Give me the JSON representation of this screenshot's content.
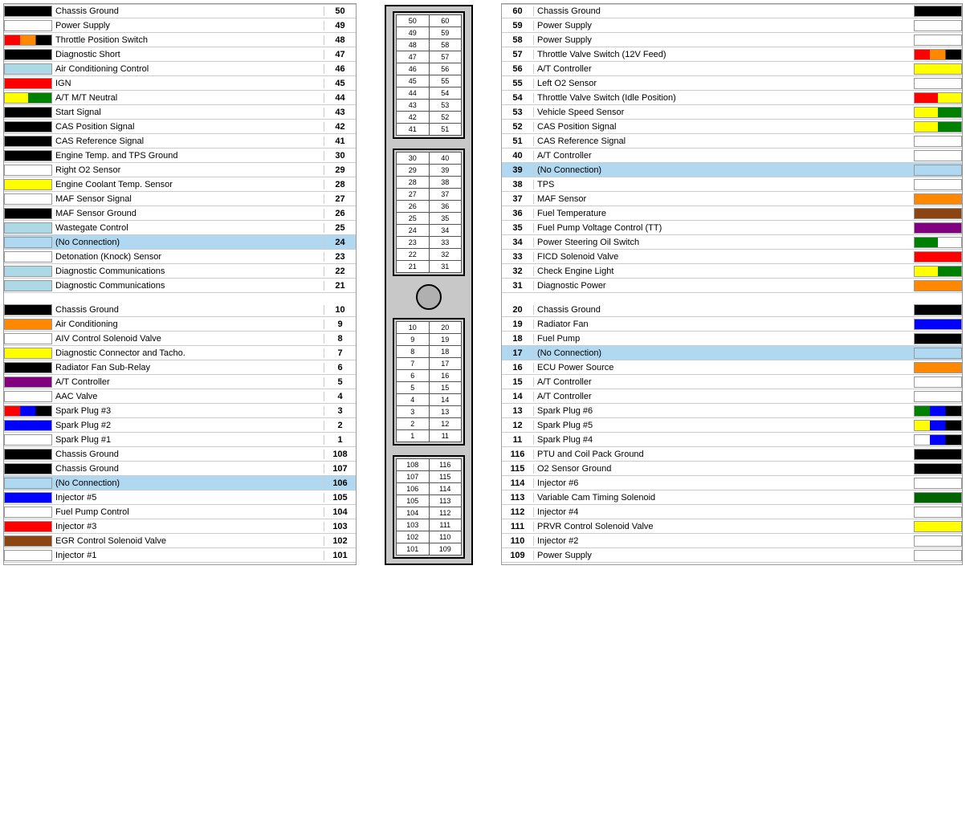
{
  "left": {
    "section1": [
      {
        "num": 50,
        "label": "Chassis Ground",
        "swatch": "swatch-black"
      },
      {
        "num": 49,
        "label": "Power Supply",
        "swatch": "swatch-none"
      },
      {
        "num": 48,
        "label": "Throttle Position Switch",
        "swatch": "swatch-multiRO"
      },
      {
        "num": 47,
        "label": "Diagnostic Short",
        "swatch": "swatch-black"
      },
      {
        "num": 46,
        "label": "Air Conditioning Control",
        "swatch": "swatch-lightblue"
      },
      {
        "num": 45,
        "label": "IGN",
        "swatch": "swatch-red"
      },
      {
        "num": 44,
        "label": "A/T M/T Neutral",
        "swatch": "swatch-multiYG"
      },
      {
        "num": 43,
        "label": "Start Signal",
        "swatch": "swatch-black"
      },
      {
        "num": 42,
        "label": "CAS Position Signal",
        "swatch": "swatch-black"
      },
      {
        "num": 41,
        "label": "CAS Reference Signal",
        "swatch": "swatch-black"
      },
      {
        "num": 30,
        "label": "Engine Temp. and TPS Ground",
        "swatch": "swatch-black"
      },
      {
        "num": 29,
        "label": "Right O2 Sensor",
        "swatch": "swatch-none"
      },
      {
        "num": 28,
        "label": "Engine Coolant Temp. Sensor",
        "swatch": "swatch-yellow"
      },
      {
        "num": 27,
        "label": "MAF Sensor Signal",
        "swatch": "swatch-none"
      },
      {
        "num": 26,
        "label": "MAF Sensor Ground",
        "swatch": "swatch-black"
      },
      {
        "num": 25,
        "label": "Wastegate Control",
        "swatch": "swatch-lightblue"
      },
      {
        "num": 24,
        "label": "(No Connection)",
        "swatch": "swatch-none",
        "nc": true
      },
      {
        "num": 23,
        "label": "Detonation (Knock) Sensor",
        "swatch": "swatch-none"
      },
      {
        "num": 22,
        "label": "Diagnostic Communications",
        "swatch": "swatch-lightblue"
      },
      {
        "num": 21,
        "label": "Diagnostic Communications",
        "swatch": "swatch-lightblue"
      }
    ],
    "section2": [
      {
        "num": 10,
        "label": "Chassis Ground",
        "swatch": "swatch-black"
      },
      {
        "num": 9,
        "label": "Air Conditioning",
        "swatch": "swatch-orange"
      },
      {
        "num": 8,
        "label": "AIV Control Solenoid Valve",
        "swatch": "swatch-none"
      },
      {
        "num": 7,
        "label": "Diagnostic Connector and Tacho.",
        "swatch": "swatch-yellow"
      },
      {
        "num": 6,
        "label": "Radiator Fan Sub-Relay",
        "swatch": "swatch-black"
      },
      {
        "num": 5,
        "label": "A/T Controller",
        "swatch": "swatch-purple"
      },
      {
        "num": 4,
        "label": "AAC Valve",
        "swatch": "swatch-none"
      },
      {
        "num": 3,
        "label": "Spark Plug #3",
        "swatch": "swatch-multiRBK"
      },
      {
        "num": 2,
        "label": "Spark Plug #2",
        "swatch": "swatch-blue"
      },
      {
        "num": 1,
        "label": "Spark Plug #1",
        "swatch": "swatch-none"
      },
      {
        "num": 108,
        "label": "Chassis Ground",
        "swatch": "swatch-black"
      },
      {
        "num": 107,
        "label": "Chassis Ground",
        "swatch": "swatch-black"
      },
      {
        "num": 106,
        "label": "(No Connection)",
        "swatch": "swatch-none",
        "nc": true
      },
      {
        "num": 105,
        "label": "Injector #5",
        "swatch": "swatch-blue"
      },
      {
        "num": 104,
        "label": "Fuel Pump Control",
        "swatch": "swatch-none"
      },
      {
        "num": 103,
        "label": "Injector #3",
        "swatch": "swatch-red"
      },
      {
        "num": 102,
        "label": "EGR Control Solenoid Valve",
        "swatch": "swatch-brown"
      },
      {
        "num": 101,
        "label": "Injector #1",
        "swatch": "swatch-none"
      }
    ]
  },
  "right": {
    "section1": [
      {
        "num": 60,
        "label": "Chassis Ground",
        "swatch": "swatch-black"
      },
      {
        "num": 59,
        "label": "Power Supply",
        "swatch": "swatch-none"
      },
      {
        "num": 58,
        "label": "Power Supply",
        "swatch": "swatch-none"
      },
      {
        "num": 57,
        "label": "Throttle Valve Switch (12V Feed)",
        "swatch": "swatch-multiRO"
      },
      {
        "num": 56,
        "label": "A/T Controller",
        "swatch": "swatch-yellow"
      },
      {
        "num": 55,
        "label": "Left O2 Sensor",
        "swatch": "swatch-none"
      },
      {
        "num": 54,
        "label": "Throttle Valve Switch (Idle Position)",
        "swatch": "swatch-multiRY"
      },
      {
        "num": 53,
        "label": "Vehicle Speed Sensor",
        "swatch": "swatch-multiYG"
      },
      {
        "num": 52,
        "label": "CAS Position Signal",
        "swatch": "swatch-multiYG"
      },
      {
        "num": 51,
        "label": "CAS Reference Signal",
        "swatch": "swatch-none"
      },
      {
        "num": 40,
        "label": "A/T Controller",
        "swatch": "swatch-none"
      },
      {
        "num": 39,
        "label": "(No Connection)",
        "swatch": "swatch-none",
        "nc": true
      },
      {
        "num": 38,
        "label": "TPS",
        "swatch": "swatch-none"
      },
      {
        "num": 37,
        "label": "MAF Sensor",
        "swatch": "swatch-orange"
      },
      {
        "num": 36,
        "label": "Fuel Temperature",
        "swatch": "swatch-brown"
      },
      {
        "num": 35,
        "label": "Fuel Pump Voltage Control (TT)",
        "swatch": "swatch-purple"
      },
      {
        "num": 34,
        "label": "Power Steering Oil Switch",
        "swatch": "swatch-multiGW"
      },
      {
        "num": 33,
        "label": "FICD Solenoid Valve",
        "swatch": "swatch-red"
      },
      {
        "num": 32,
        "label": "Check Engine Light",
        "swatch": "swatch-multiYG"
      },
      {
        "num": 31,
        "label": "Diagnostic Power",
        "swatch": "swatch-orange"
      }
    ],
    "section2": [
      {
        "num": 20,
        "label": "Chassis Ground",
        "swatch": "swatch-black"
      },
      {
        "num": 19,
        "label": "Radiator Fan",
        "swatch": "swatch-blue"
      },
      {
        "num": 18,
        "label": "Fuel Pump",
        "swatch": "swatch-black"
      },
      {
        "num": 17,
        "label": "(No Connection)",
        "swatch": "swatch-none",
        "nc": true
      },
      {
        "num": 16,
        "label": "ECU Power Source",
        "swatch": "swatch-orange"
      },
      {
        "num": 15,
        "label": "A/T Controller",
        "swatch": "swatch-none"
      },
      {
        "num": 14,
        "label": "A/T Controller",
        "swatch": "swatch-none"
      },
      {
        "num": 13,
        "label": "Spark Plug #6",
        "swatch": "swatch-multiGBK"
      },
      {
        "num": 12,
        "label": "Spark Plug #5",
        "swatch": "swatch-multiYBK"
      },
      {
        "num": 11,
        "label": "Spark Plug #4",
        "swatch": "swatch-multiWBK"
      },
      {
        "num": 116,
        "label": "PTU and Coil Pack Ground",
        "swatch": "swatch-black"
      },
      {
        "num": 115,
        "label": "O2 Sensor Ground",
        "swatch": "swatch-black"
      },
      {
        "num": 114,
        "label": "Injector #6",
        "swatch": "swatch-none"
      },
      {
        "num": 113,
        "label": "Variable Cam Timing Solenoid",
        "swatch": "swatch-darkgreen"
      },
      {
        "num": 112,
        "label": "Injector #4",
        "swatch": "swatch-none"
      },
      {
        "num": 111,
        "label": "PRVR Control Solenoid Valve",
        "swatch": "swatch-yellow"
      },
      {
        "num": 110,
        "label": "Injector #2",
        "swatch": "swatch-none"
      },
      {
        "num": 109,
        "label": "Power Supply",
        "swatch": "swatch-none"
      }
    ]
  },
  "center": {
    "topGrid": [
      [
        50,
        60
      ],
      [
        49,
        59
      ],
      [
        48,
        58
      ],
      [
        47,
        57
      ],
      [
        46,
        56
      ],
      [
        45,
        55
      ],
      [
        44,
        54
      ],
      [
        43,
        53
      ],
      [
        42,
        52
      ],
      [
        41,
        51
      ]
    ],
    "midGrid": [
      [
        30,
        40
      ],
      [
        29,
        39
      ],
      [
        28,
        38
      ],
      [
        27,
        37
      ],
      [
        26,
        36
      ],
      [
        25,
        35
      ],
      [
        24,
        34
      ],
      [
        23,
        33
      ],
      [
        22,
        32
      ],
      [
        21,
        31
      ]
    ],
    "lowGrid": [
      [
        10,
        20
      ],
      [
        9,
        19
      ],
      [
        8,
        18
      ],
      [
        7,
        17
      ],
      [
        6,
        16
      ],
      [
        5,
        15
      ],
      [
        4,
        14
      ],
      [
        3,
        13
      ],
      [
        2,
        12
      ],
      [
        1,
        11
      ]
    ],
    "botGrid": [
      [
        108,
        116
      ],
      [
        107,
        115
      ],
      [
        106,
        114
      ],
      [
        105,
        113
      ],
      [
        104,
        112
      ],
      [
        103,
        111
      ],
      [
        102,
        110
      ],
      [
        101,
        109
      ]
    ]
  }
}
